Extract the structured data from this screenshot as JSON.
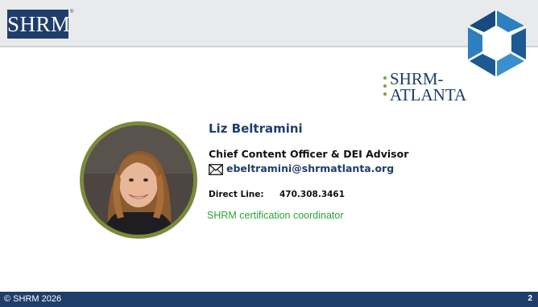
{
  "header": {
    "logo_text": "SHRM",
    "logo_mark": "®"
  },
  "brand": {
    "hex_logo_icon": "shrm-hexagon-logo-icon",
    "atlanta_line1": "SHRM-",
    "atlanta_line2": "ATLANTA"
  },
  "contact": {
    "name": "Liz Beltramini",
    "title": "Chief Content Officer & DEI Advisor",
    "email_icon": "envelope-icon",
    "email": "ebeltramini@shrmatlanta.org",
    "direct_label": "Direct Line:",
    "direct_number": "470.308.3461",
    "note": "SHRM certification coordinator"
  },
  "footer": {
    "copyright": "© SHRM 2026",
    "page_number": "2"
  },
  "colors": {
    "navy": "#1f3d6b",
    "header_gray": "#e9eaeb",
    "olive_ring": "#7a8a3a",
    "note_green": "#2aa43a",
    "hex_blue_dark": "#1f5f98",
    "hex_blue_light": "#3b8fd1"
  }
}
